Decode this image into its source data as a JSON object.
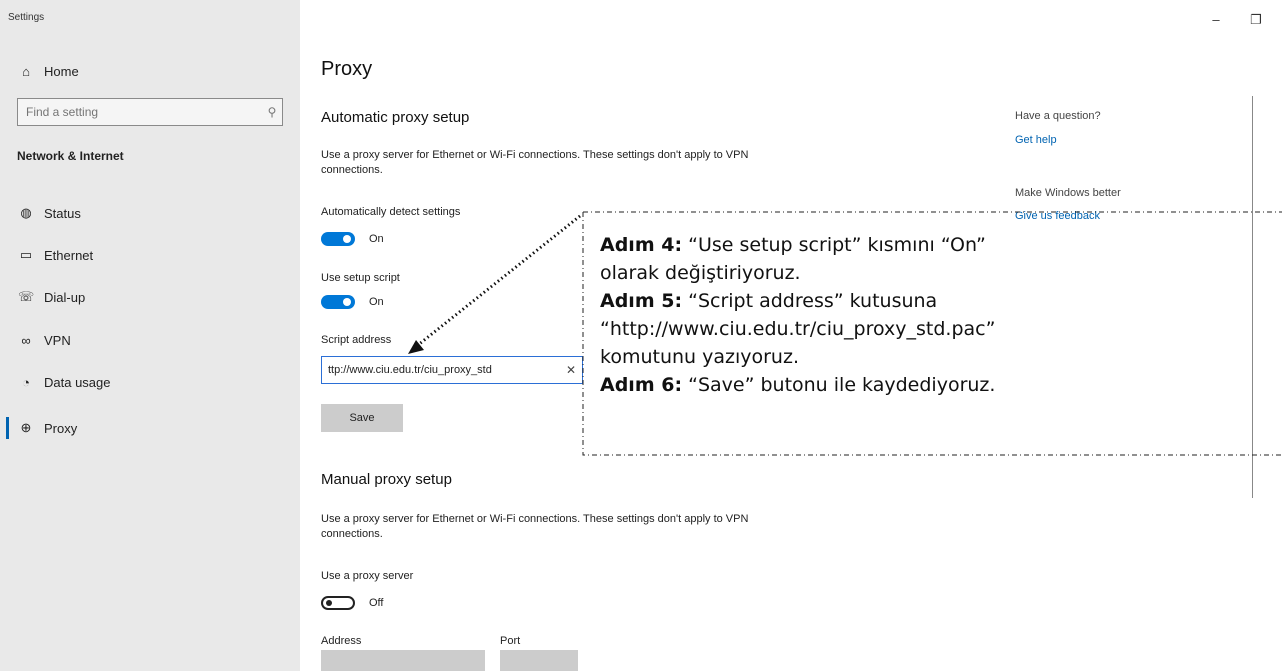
{
  "window": {
    "title": "Settings",
    "minimize": "–",
    "restore": "❐",
    "close": "✕"
  },
  "sidebar": {
    "home_label": "Home",
    "search_placeholder": "Find a setting",
    "section": "Network & Internet",
    "items": [
      {
        "label": "Status",
        "icon": "status-icon"
      },
      {
        "label": "Ethernet",
        "icon": "ethernet-icon"
      },
      {
        "label": "Dial-up",
        "icon": "dialup-icon"
      },
      {
        "label": "VPN",
        "icon": "vpn-icon"
      },
      {
        "label": "Data usage",
        "icon": "data-usage-icon"
      },
      {
        "label": "Proxy",
        "icon": "globe-icon",
        "active": true
      }
    ]
  },
  "main": {
    "title": "Proxy",
    "automatic": {
      "heading": "Automatic proxy setup",
      "description": "Use a proxy server for Ethernet or Wi-Fi connections. These settings don't apply to VPN connections.",
      "detect_label": "Automatically detect settings",
      "detect_state": "On",
      "script_label": "Use setup script",
      "script_state": "On",
      "address_label": "Script address",
      "address_value": "ttp://www.ciu.edu.tr/ciu_proxy_std",
      "save_label": "Save"
    },
    "manual": {
      "heading": "Manual proxy setup",
      "description": "Use a proxy server for Ethernet or Wi-Fi connections. These settings don't apply to VPN connections.",
      "use_proxy_label": "Use a proxy server",
      "use_proxy_state": "Off",
      "address_label": "Address",
      "port_label": "Port"
    }
  },
  "help": {
    "question": "Have a question?",
    "get_help": "Get help",
    "better": "Make Windows better",
    "feedback": "Give us feedback"
  },
  "callout": {
    "step4_prefix": "Adım 4:",
    "step4_text": " “Use setup script” kısmını “On” olarak değiştiriyoruz.",
    "step5_prefix": "Adım 5:",
    "step5_text": " “Script address” kutusuna “http://www.ciu.edu.tr/ciu_proxy_std.pac” komutunu yazıyoruz.",
    "step6_prefix": "Adım 6:",
    "step6_text": " “Save” butonu ile kaydediyoruz."
  },
  "colors": {
    "accent": "#0078d7",
    "link": "#0063b1",
    "sidebar_bg": "#e9e9e9"
  }
}
